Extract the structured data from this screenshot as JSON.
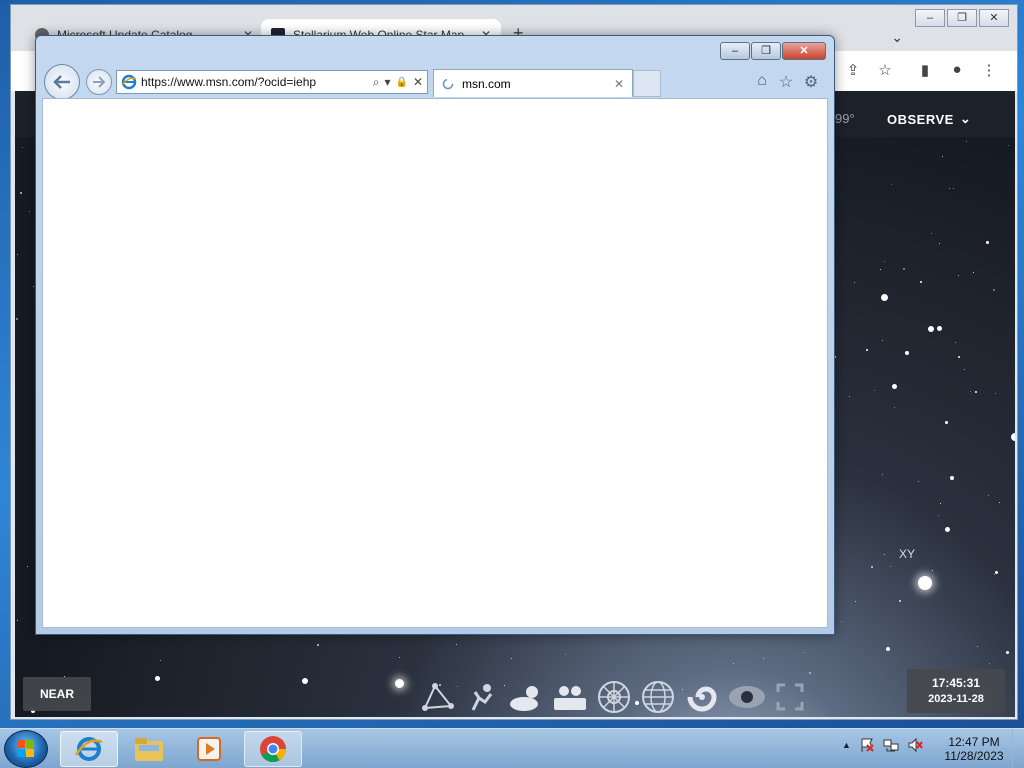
{
  "chrome": {
    "tabs": [
      {
        "title": "Microsoft Update Catalog"
      },
      {
        "title": "Stellarium Web Online Star Map"
      }
    ],
    "new_tab": "+",
    "dropdown": "⌄",
    "caption": {
      "minimize": "–",
      "restore": "❐",
      "close": "✕"
    },
    "toolbar": {
      "share": "⇪",
      "bookmark": "☆",
      "sidebar": "▮",
      "profile": "●",
      "menu": "⋮"
    }
  },
  "stellarium": {
    "degrees": "99°",
    "observe_label": "OBSERVE",
    "observe_chevron": "⌄",
    "star_label": "XY",
    "near_label": "NEAR",
    "time": "17:45:31",
    "date": "2023-11-28",
    "toolbar": [
      "constellations-icon",
      "constellation-art-icon",
      "atmosphere-icon",
      "landscape-icon",
      "azimuthal-grid-icon",
      "equatorial-grid-icon",
      "deep-sky-icon",
      "night-mode-icon",
      "fullscreen-icon"
    ]
  },
  "ie": {
    "url": "https://www.msn.com/?ocid=iehp",
    "tab_title": "msn.com",
    "tab_close": "✕",
    "addr_search": "⌕",
    "addr_dropdown": "▾",
    "addr_lock": "🔒",
    "addr_stop": "✕",
    "caption": {
      "minimize": "–",
      "restore": "❐",
      "close": "✕"
    },
    "tools": {
      "home": "⌂",
      "favorites": "☆",
      "settings": "⚙"
    }
  },
  "taskbar": {
    "clock_time": "12:47 PM",
    "clock_date": "11/28/2023",
    "tray": {
      "show_hidden": "▲"
    }
  },
  "colors": {
    "ie_close": "#c9442f",
    "taskbar": "#7ea6cf",
    "sky": "#161a22"
  }
}
